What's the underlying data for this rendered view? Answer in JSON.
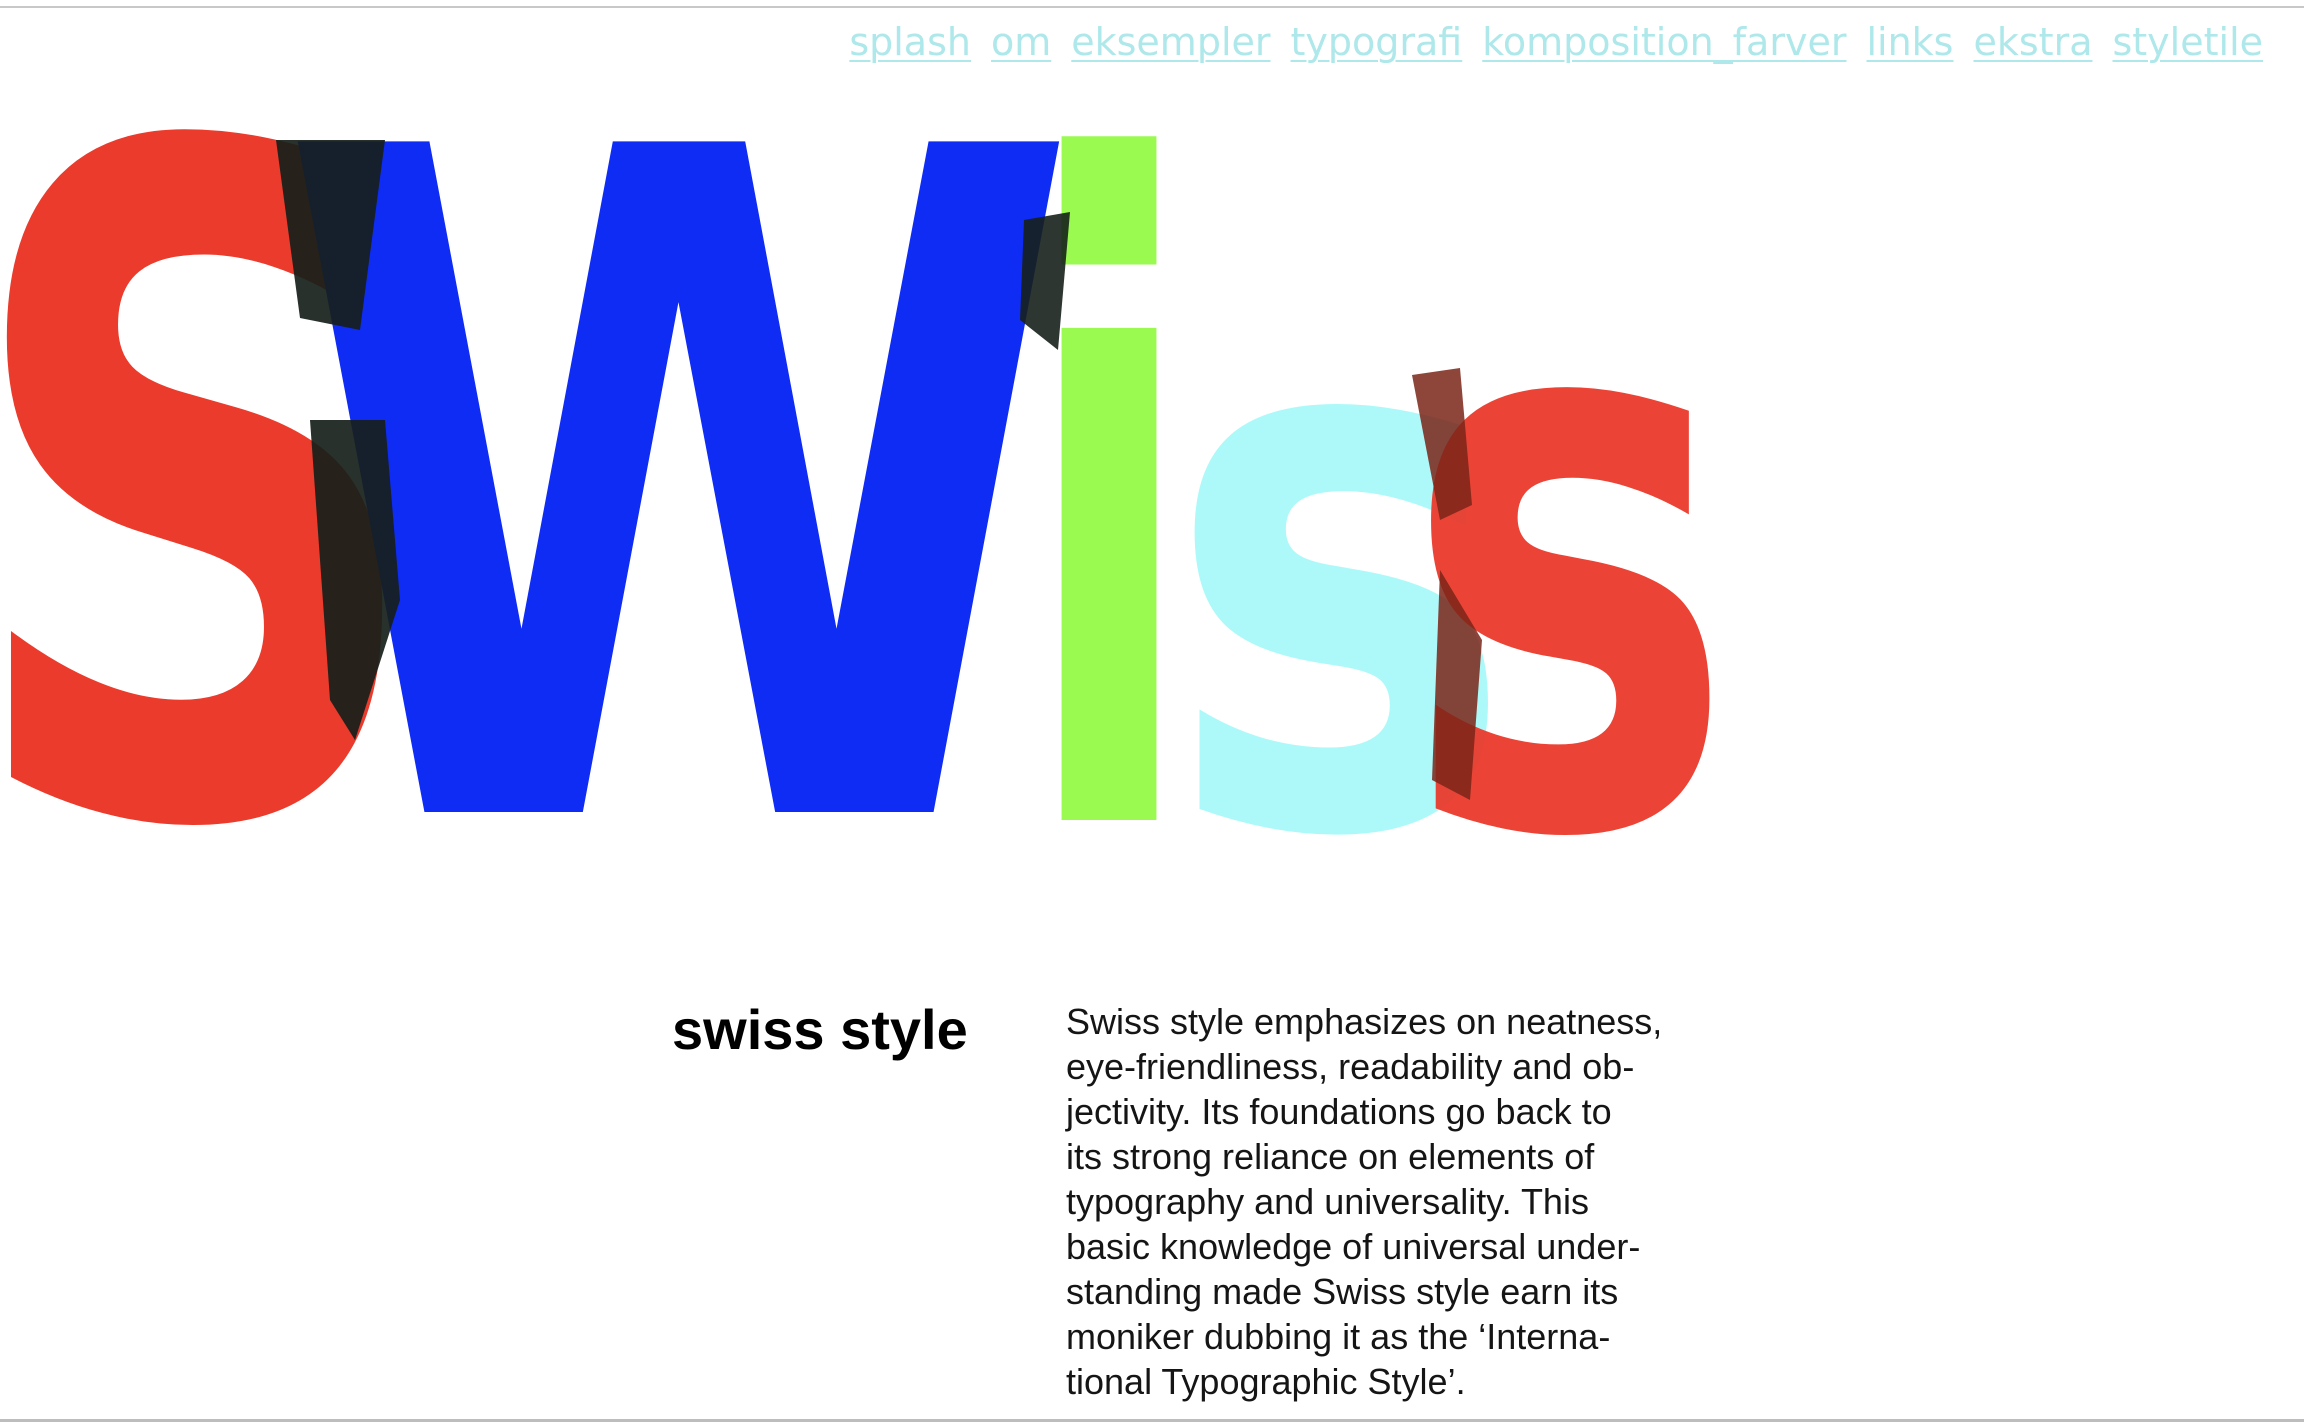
{
  "nav": {
    "items": [
      {
        "label": "splash"
      },
      {
        "label": "om"
      },
      {
        "label": "eksempler"
      },
      {
        "label": "typografi"
      },
      {
        "label": "komposition_farver"
      },
      {
        "label": "links"
      },
      {
        "label": "ekstra"
      },
      {
        "label": "styletile"
      }
    ]
  },
  "hero": {
    "letters": {
      "s1": "S",
      "w": "W",
      "i": "i",
      "s2": "s",
      "s3": "s"
    },
    "colors": {
      "red": "#ea3b2c",
      "blue": "#0f2cf5",
      "green": "#9afa50",
      "cyan": "#a9f9f9",
      "overlap": "#16201a"
    }
  },
  "section": {
    "heading": "swiss style",
    "body_lines": [
      "Swiss style emphasizes on neatness,",
      "eye-friendliness, readability and ob-",
      "jectivity. Its foundations go back to",
      "its strong reliance on elements of",
      "typography and universality. This",
      "basic knowledge of universal under-",
      "standing made Swiss style earn its",
      "moniker dubbing it as the ‘Interna-",
      "tional Typographic Style’."
    ]
  },
  "theme": {
    "link_color": "#aee8ea",
    "text_color": "#151515"
  }
}
